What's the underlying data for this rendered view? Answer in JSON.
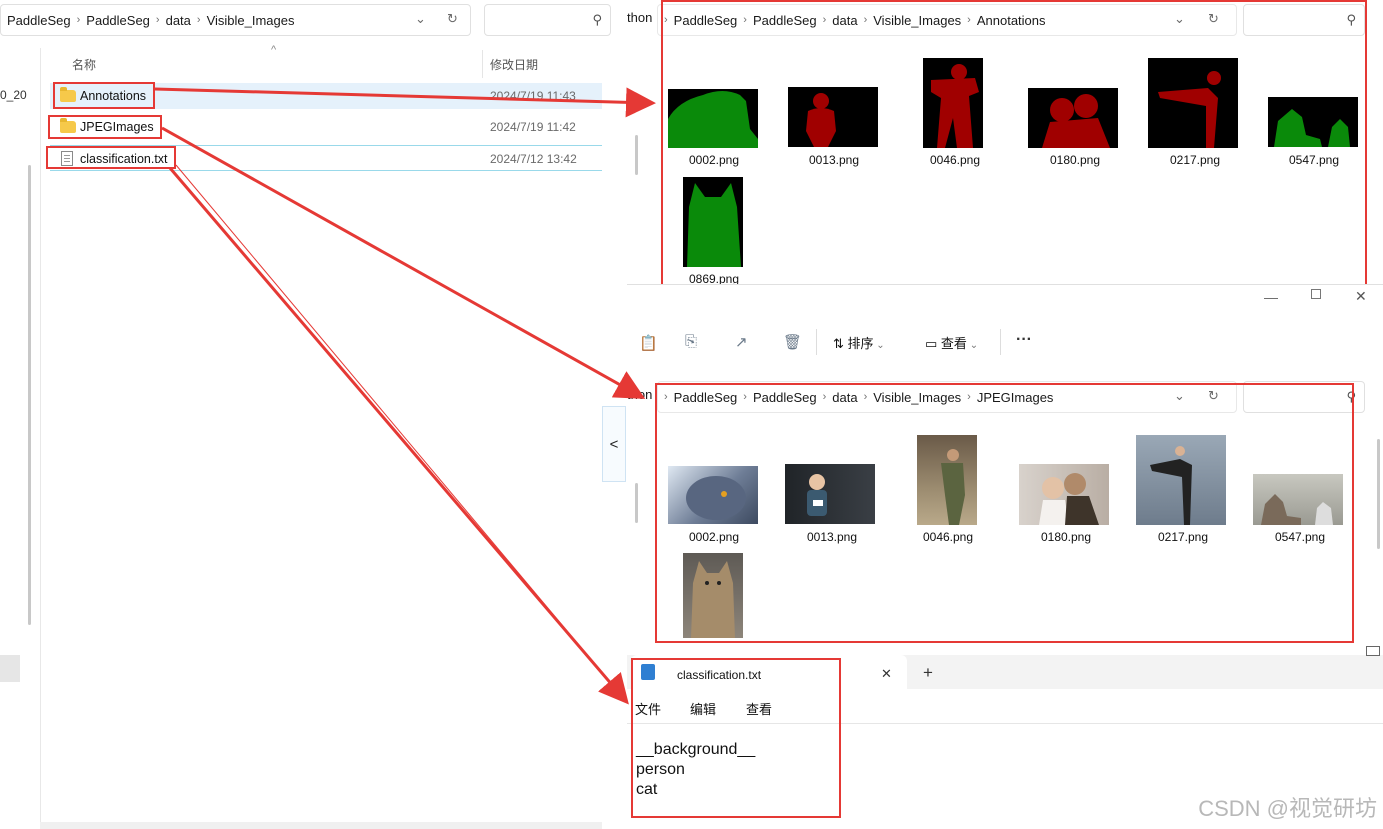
{
  "left_explorer": {
    "breadcrumb": [
      "PaddleSeg",
      "PaddleSeg",
      "data",
      "Visible_Images"
    ],
    "left_edge_text": "0_20",
    "columns": {
      "name": "名称",
      "modified": "修改日期"
    },
    "files": [
      {
        "name": "Annotations",
        "date": "2024/7/19 11:43",
        "type": "folder"
      },
      {
        "name": "JPEGImages",
        "date": "2024/7/19 11:42",
        "type": "folder"
      },
      {
        "name": "classification.txt",
        "date": "2024/7/12 13:42",
        "type": "text"
      }
    ],
    "collapse_arrow": "<"
  },
  "annotations_window": {
    "breadcrumb_prefix": "thon",
    "breadcrumb": [
      "PaddleSeg",
      "PaddleSeg",
      "data",
      "Visible_Images",
      "Annotations"
    ],
    "files": [
      "0002.png",
      "0013.png",
      "0046.png",
      "0180.png",
      "0217.png",
      "0547.png",
      "0869.png"
    ],
    "colors": {
      "person": "#a00000",
      "cat": "#0a8a0a",
      "background": "#000000"
    }
  },
  "jpeg_window": {
    "toolbar": {
      "sort_label": "排序",
      "view_label": "查看",
      "more": "···"
    },
    "breadcrumb_prefix": "thon",
    "breadcrumb": [
      "PaddleSeg",
      "PaddleSeg",
      "data",
      "Visible_Images",
      "JPEGImages"
    ],
    "files": [
      "0002.png",
      "0013.png",
      "0046.png",
      "0180.png",
      "0217.png",
      "0547.png"
    ]
  },
  "notepad": {
    "tab_title": "classification.txt",
    "close": "✕",
    "new_tab": "+",
    "menu": [
      "文件",
      "编辑",
      "查看"
    ],
    "lines": [
      "__background__",
      "person",
      "cat"
    ]
  },
  "watermark": "CSDN @视觉研坊",
  "accent": {
    "annotation_red": "#e53935",
    "selection_blue": "#e5f1fb"
  }
}
